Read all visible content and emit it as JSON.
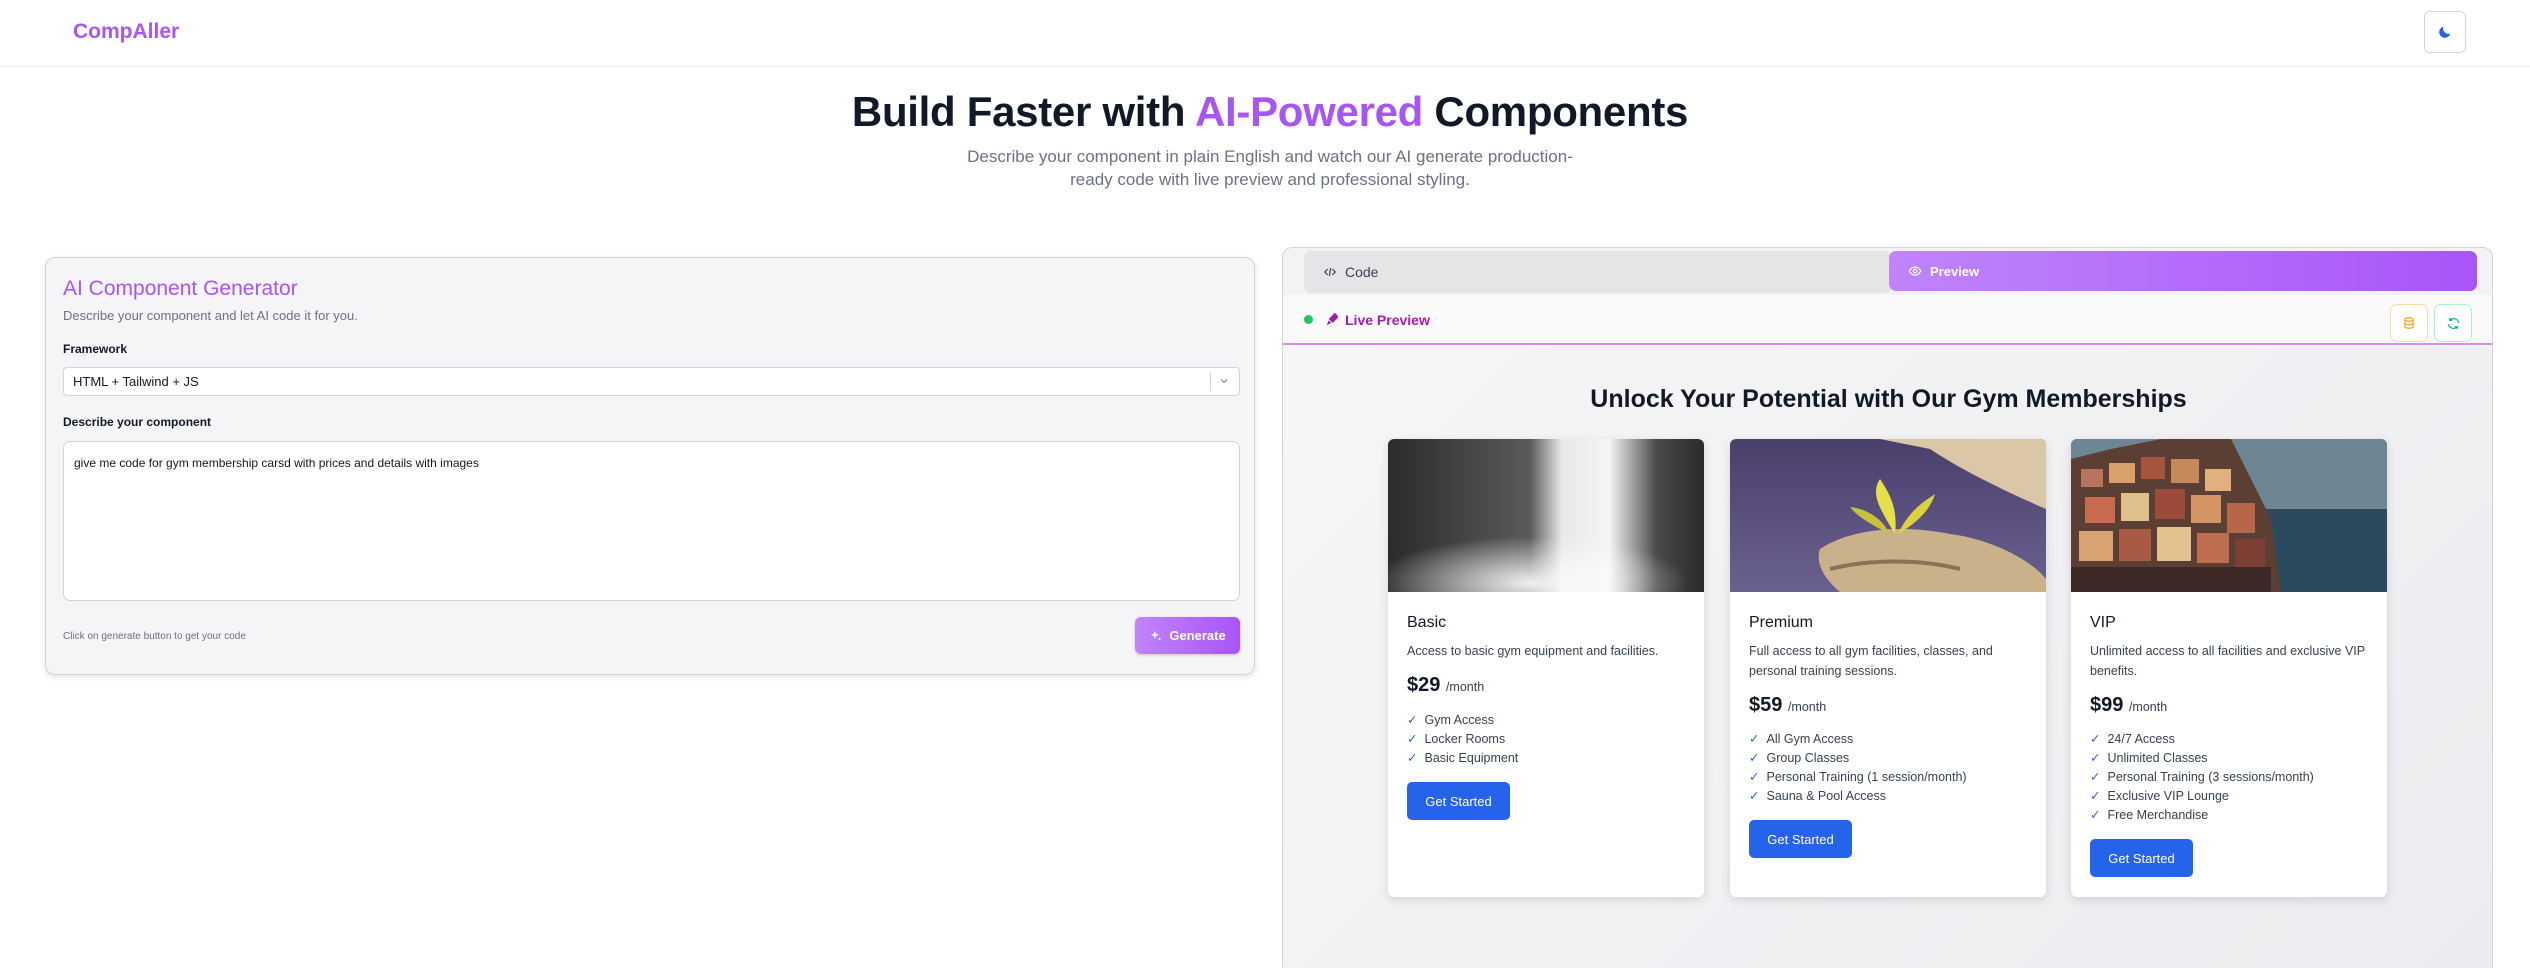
{
  "header": {
    "brand": "CompAller",
    "theme_icon": "moon-icon"
  },
  "hero": {
    "title_pre": "Build Faster with ",
    "title_accent": "AI-Powered",
    "title_post": " Components",
    "subtitle": "Describe your component in plain English and watch our AI generate production-ready code with live preview and professional styling."
  },
  "generator": {
    "title": "AI Component Generator",
    "description": "Describe your component and let AI code it for you.",
    "framework_label": "Framework",
    "framework_value": "HTML + Tailwind + JS",
    "describe_label": "Describe your component",
    "prompt_value": "give me code for gym membership carsd with prices and details with images",
    "hint": "Click on generate button to get your code",
    "generate_label": "Generate"
  },
  "preview_panel": {
    "tabs": [
      {
        "label": "Code",
        "icon": "code-icon",
        "active": false
      },
      {
        "label": "Preview",
        "icon": "eye-icon",
        "active": true
      }
    ],
    "live_label": "Live Preview",
    "tools": [
      "database-icon",
      "refresh-icon"
    ],
    "heading": "Unlock Your Potential with Our Gym Memberships",
    "plans": [
      {
        "name": "Basic",
        "description": "Access to basic gym equipment and facilities.",
        "price": "$29",
        "period": "/month",
        "features": [
          "Gym Access",
          "Locker Rooms",
          "Basic Equipment"
        ],
        "cta": "Get Started",
        "image": "waterfall-grayscale"
      },
      {
        "name": "Premium",
        "description": "Full access to all gym facilities, classes, and personal training sessions.",
        "price": "$59",
        "period": "/month",
        "features": [
          "All Gym Access",
          "Group Classes",
          "Personal Training (1 session/month)",
          "Sauna & Pool Access"
        ],
        "cta": "Get Started",
        "image": "leaf-on-rock"
      },
      {
        "name": "VIP",
        "description": "Unlimited access to all facilities and exclusive VIP benefits.",
        "price": "$99",
        "period": "/month",
        "features": [
          "24/7 Access",
          "Unlimited Classes",
          "Personal Training (3 sessions/month)",
          "Exclusive VIP Lounge",
          "Free Merchandise"
        ],
        "cta": "Get Started",
        "image": "cliffside-village"
      }
    ],
    "check_glyph": "✓"
  },
  "colors": {
    "accent": "#a855f7",
    "cta": "#2563eb",
    "live": "#22c55e"
  }
}
